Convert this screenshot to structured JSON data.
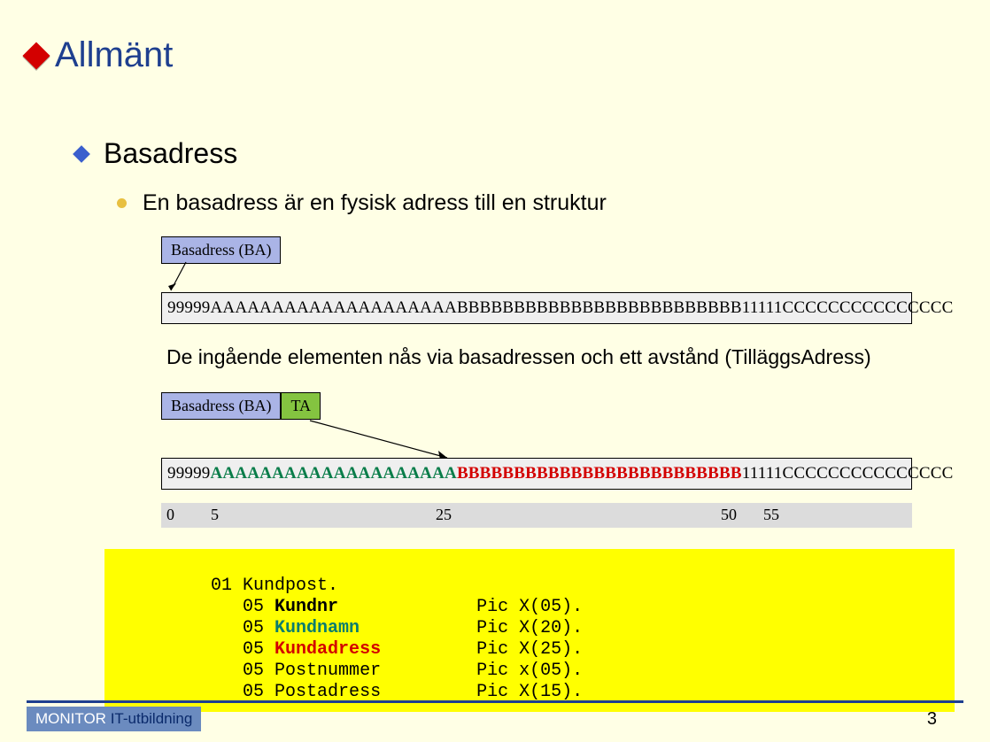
{
  "title": "Allmänt",
  "sub1": "Basadress",
  "sub2": "En basadress är en fysisk adress till en struktur",
  "ba_label": "Basadress (BA)",
  "ta_label": "TA",
  "memory": {
    "seg_9": "99999",
    "seg_a": "AAAAAAAAAAAAAAAAAAAA",
    "seg_b": "BBBBBBBBBBBBBBBBBBBBBBBBB",
    "seg_1": "11111",
    "seg_c": "CCCCCCCCCCCCCCC"
  },
  "desc2": "De ingående elementen nås via basadressen och ett avstånd (TilläggsAdress)",
  "offsets": {
    "p0": "0",
    "p5": "5",
    "p25": "25",
    "p50": "50",
    "p55": "55"
  },
  "code": {
    "l1": "01 Kundpost.",
    "r2_level": "05 ",
    "r2_name": "Kundnr",
    "r2_pic": "Pic X(05).",
    "r3_name": "Kundnamn",
    "r3_pic": "Pic X(20).",
    "r4_name": "Kundadress",
    "r4_pic": "Pic X(25).",
    "r5_name": "Postnummer",
    "r5_pic": "Pic x(05).",
    "r6_name": "Postadress",
    "r6_pic": "Pic X(15)."
  },
  "footer": {
    "brand": "MONITOR ",
    "brand2": "IT-utbildning",
    "page": "3"
  }
}
